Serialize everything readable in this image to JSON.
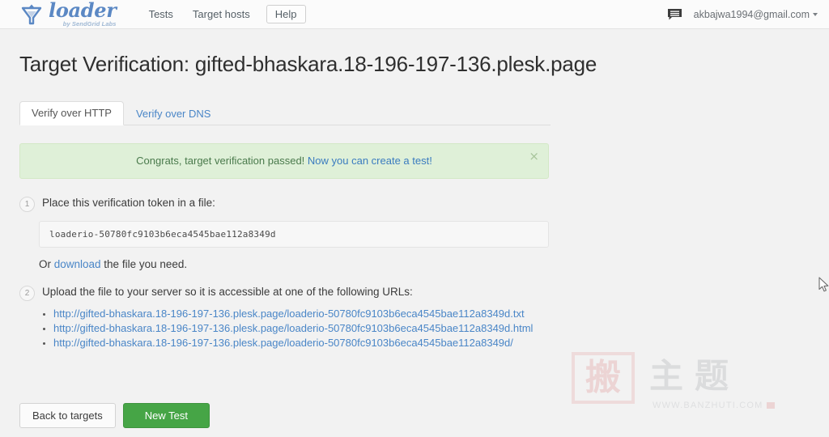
{
  "header": {
    "brand": {
      "name": "loader",
      "subtitle": "by SendGrid Labs",
      "logo_icon": "loader-funnel-logo-icon"
    },
    "nav": [
      {
        "label": "Tests",
        "boxed": false
      },
      {
        "label": "Target hosts",
        "boxed": false
      },
      {
        "label": "Help",
        "boxed": true
      }
    ],
    "messages_icon": "messages-icon",
    "user_email": "akbajwa1994@gmail.com",
    "user_caret_icon": "chevron-down-icon"
  },
  "main": {
    "page_title": "Target Verification: gifted-bhaskara.18-196-197-136.plesk.page",
    "tabs": [
      {
        "label": "Verify over HTTP",
        "active": true
      },
      {
        "label": "Verify over DNS",
        "active": false
      }
    ],
    "alert": {
      "message": "Congrats, target verification passed!",
      "link_text": "Now you can create a test!",
      "close_icon": "×",
      "bg_color": "#dff0d8",
      "text_color": "#4a7a4c"
    },
    "steps": [
      {
        "number": "1",
        "label": "Place this verification token in a file:"
      },
      {
        "number": "2",
        "label": "Upload the file to your server so it is accessible at one of the following URLs:"
      }
    ],
    "token": "loaderio-50780fc9103b6eca4545bae112a8349d",
    "download_prefix": "Or ",
    "download_link": "download",
    "download_suffix": " the file you need.",
    "urls": [
      "http://gifted-bhaskara.18-196-197-136.plesk.page/loaderio-50780fc9103b6eca4545bae112a8349d.txt",
      "http://gifted-bhaskara.18-196-197-136.plesk.page/loaderio-50780fc9103b6eca4545bae112a8349d.html",
      "http://gifted-bhaskara.18-196-197-136.plesk.page/loaderio-50780fc9103b6eca4545bae112a8349d/"
    ],
    "buttons": {
      "back": "Back to targets",
      "new_test": "New Test",
      "primary_color": "#46a546"
    }
  },
  "watermark": {
    "seal_char": "搬",
    "chars": "主题",
    "url": "WWW.BANZHUTI.COM"
  },
  "cursor": {
    "icon": "mouse-pointer-icon"
  }
}
